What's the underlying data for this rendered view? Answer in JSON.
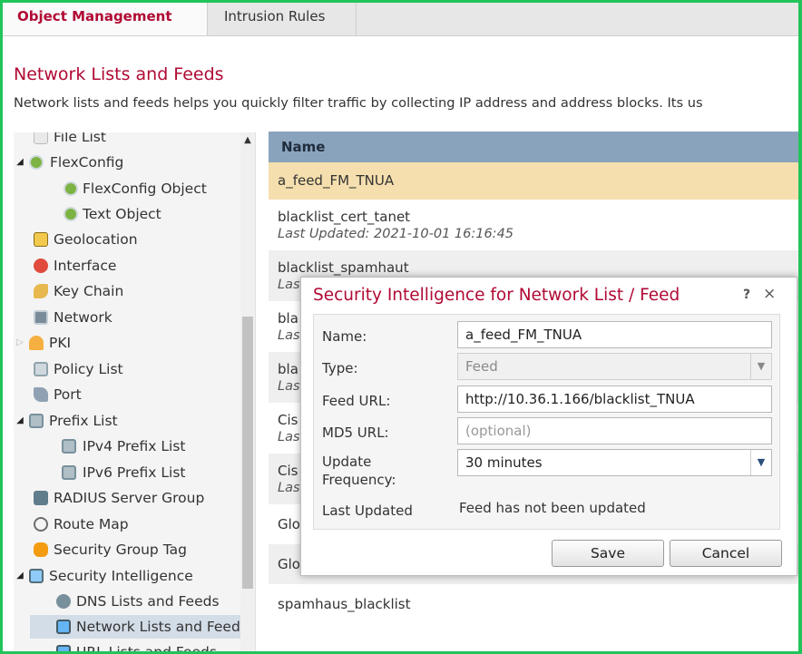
{
  "tabs": [
    {
      "label": "Object Management"
    },
    {
      "label": "Intrusion Rules"
    }
  ],
  "page": {
    "title": "Network Lists and Feeds",
    "description": "Network lists and feeds helps you quickly filter traffic by collecting IP address and address blocks. Its us"
  },
  "sidebar": {
    "items": [
      {
        "label": "File List"
      },
      {
        "label": "FlexConfig"
      },
      {
        "label": "FlexConfig Object"
      },
      {
        "label": "Text Object"
      },
      {
        "label": "Geolocation"
      },
      {
        "label": "Interface"
      },
      {
        "label": "Key Chain"
      },
      {
        "label": "Network"
      },
      {
        "label": "PKI"
      },
      {
        "label": "Policy List"
      },
      {
        "label": "Port"
      },
      {
        "label": "Prefix List"
      },
      {
        "label": "IPv4 Prefix List"
      },
      {
        "label": "IPv6 Prefix List"
      },
      {
        "label": "RADIUS Server Group"
      },
      {
        "label": "Route Map"
      },
      {
        "label": "Security Group Tag"
      },
      {
        "label": "Security Intelligence"
      },
      {
        "label": "DNS Lists and Feeds"
      },
      {
        "label": "Network Lists and Feeds"
      },
      {
        "label": "URL Lists and Feeds"
      }
    ]
  },
  "list": {
    "header": "Name",
    "rows": [
      {
        "name": "a_feed_FM_TNUA",
        "sub": ""
      },
      {
        "name": "blacklist_cert_tanet",
        "sub": "Last Updated: 2021-10-01 16:16:45"
      },
      {
        "name": "blacklist_spamhaut",
        "sub": "Las"
      },
      {
        "name": "bla",
        "sub": "Las"
      },
      {
        "name": "bla",
        "sub": "Las"
      },
      {
        "name": "Cis",
        "sub": "Las"
      },
      {
        "name": "Cis",
        "sub": "Las"
      },
      {
        "name": "Glo",
        "sub": ""
      },
      {
        "name": "Glo",
        "sub": ""
      },
      {
        "name": "spamhaus_blacklist",
        "sub": ""
      }
    ]
  },
  "dialog": {
    "title": "Security Intelligence for Network List / Feed",
    "help": "?",
    "close": "×",
    "fields": {
      "name_label": "Name:",
      "name_value": "a_feed_FM_TNUA",
      "type_label": "Type:",
      "type_value": "Feed",
      "feed_url_label": "Feed URL:",
      "feed_url_value": "http://10.36.1.166/blacklist_TNUA",
      "md5_url_label": "MD5 URL:",
      "md5_url_placeholder": "(optional)",
      "update_label_1": "Update",
      "update_label_2": "Frequency:",
      "update_value": "30 minutes",
      "last_updated_label": "Last Updated",
      "last_updated_value": "Feed has not been updated"
    },
    "save_label": "Save",
    "cancel_label": "Cancel"
  },
  "colors": {
    "accent": "#b00a34",
    "frame": "#22c45a",
    "header": "#8aa3bd",
    "selected_row": "#f5dfae"
  }
}
